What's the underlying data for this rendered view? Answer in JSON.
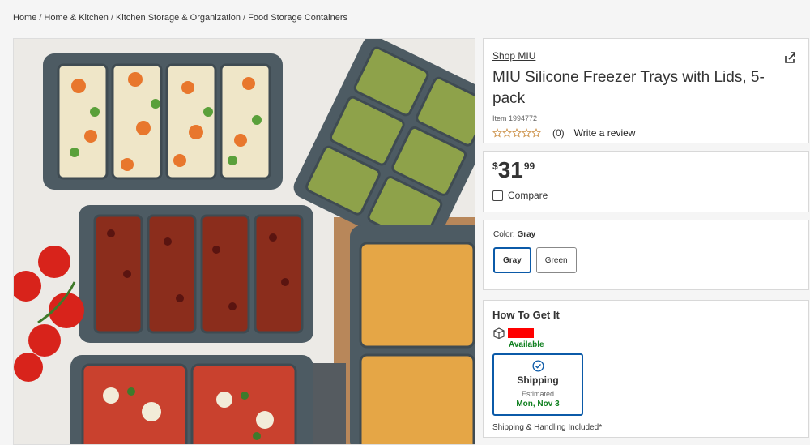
{
  "breadcrumb": [
    "Home",
    "Home & Kitchen",
    "Kitchen Storage & Organization",
    "Food Storage Containers"
  ],
  "product": {
    "shop": "Shop MIU",
    "title": "MIU Silicone Freezer Trays with Lids, 5-pack",
    "item_number": "Item 1994772",
    "review_count": "(0)",
    "write_review": "Write a review",
    "stars": 5
  },
  "price": {
    "dollar": "$",
    "whole": "31",
    "cents": "99"
  },
  "compare_label": "Compare",
  "color": {
    "label": "Color: ",
    "selected": "Gray",
    "options": [
      "Gray",
      "Green"
    ]
  },
  "delivery": {
    "heading": "How To Get It",
    "availability": "Available",
    "method": "Shipping",
    "estimated_label": "Estimated",
    "date": "Mon, Nov 3",
    "note": "Shipping & Handling Included*"
  },
  "icons": [
    "share-icon",
    "star-icon",
    "box-icon",
    "check-circle-icon"
  ],
  "colors": {
    "accent": "#0b5aa8",
    "available_green": "#108020",
    "tray_gray": "#4d5b63"
  }
}
